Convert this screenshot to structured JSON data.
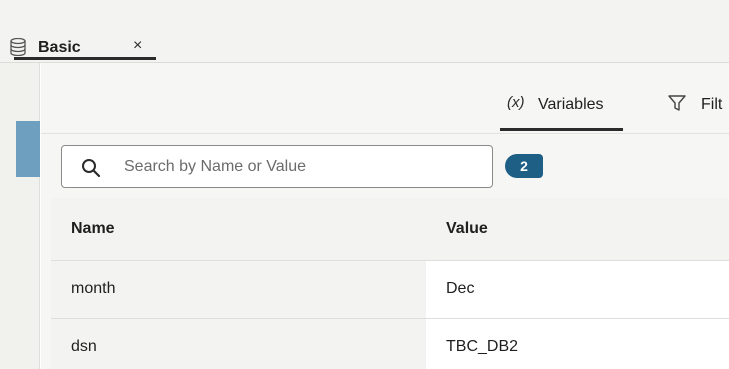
{
  "tab": {
    "label": "Basic",
    "icon": "database-icon",
    "close": "×"
  },
  "panel": {
    "tabs": [
      {
        "label": "Variables",
        "icon": "variables-icon"
      },
      {
        "label": "Filt",
        "icon": "filter-icon"
      }
    ]
  },
  "search": {
    "placeholder": "Search by Name or Value",
    "value": "",
    "count": "2"
  },
  "table": {
    "columns": [
      "Name",
      "Value"
    ],
    "rows": [
      {
        "name": "month",
        "value": "Dec"
      },
      {
        "name": "dsn",
        "value": "TBC_DB2"
      }
    ]
  },
  "colors": {
    "accent": "#1e5f86",
    "gutter_accent": "#6f9fbf"
  }
}
